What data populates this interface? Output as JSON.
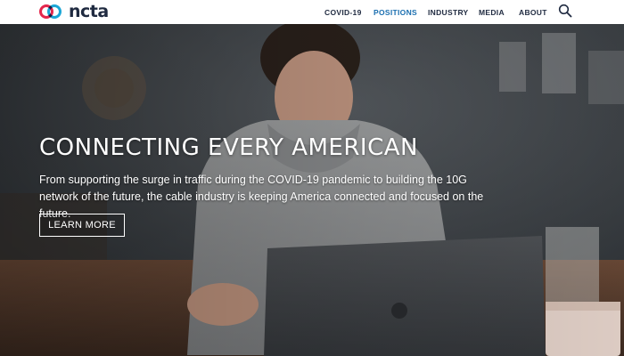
{
  "brand": {
    "name": "ncta"
  },
  "nav": {
    "items": [
      {
        "label": "COVID-19",
        "active": false
      },
      {
        "label": "POSITIONS",
        "active": true
      },
      {
        "label": "INDUSTRY",
        "active": false
      },
      {
        "label": "MEDIA",
        "active": false
      },
      {
        "label": "ABOUT",
        "active": false
      }
    ],
    "search_icon": "search-icon"
  },
  "hero": {
    "title": "CONNECTING EVERY AMERICAN",
    "body": "From supporting the surge in traffic during the COVID-19 pandemic to building the 10G network of the future, the cable industry is keeping America connected and focused on the future.",
    "cta_label": "LEARN MORE"
  },
  "colors": {
    "logo_red": "#e4264c",
    "logo_blue": "#1aa6d6",
    "nav_text": "#1f2a40",
    "nav_active": "#1b6fb0"
  }
}
